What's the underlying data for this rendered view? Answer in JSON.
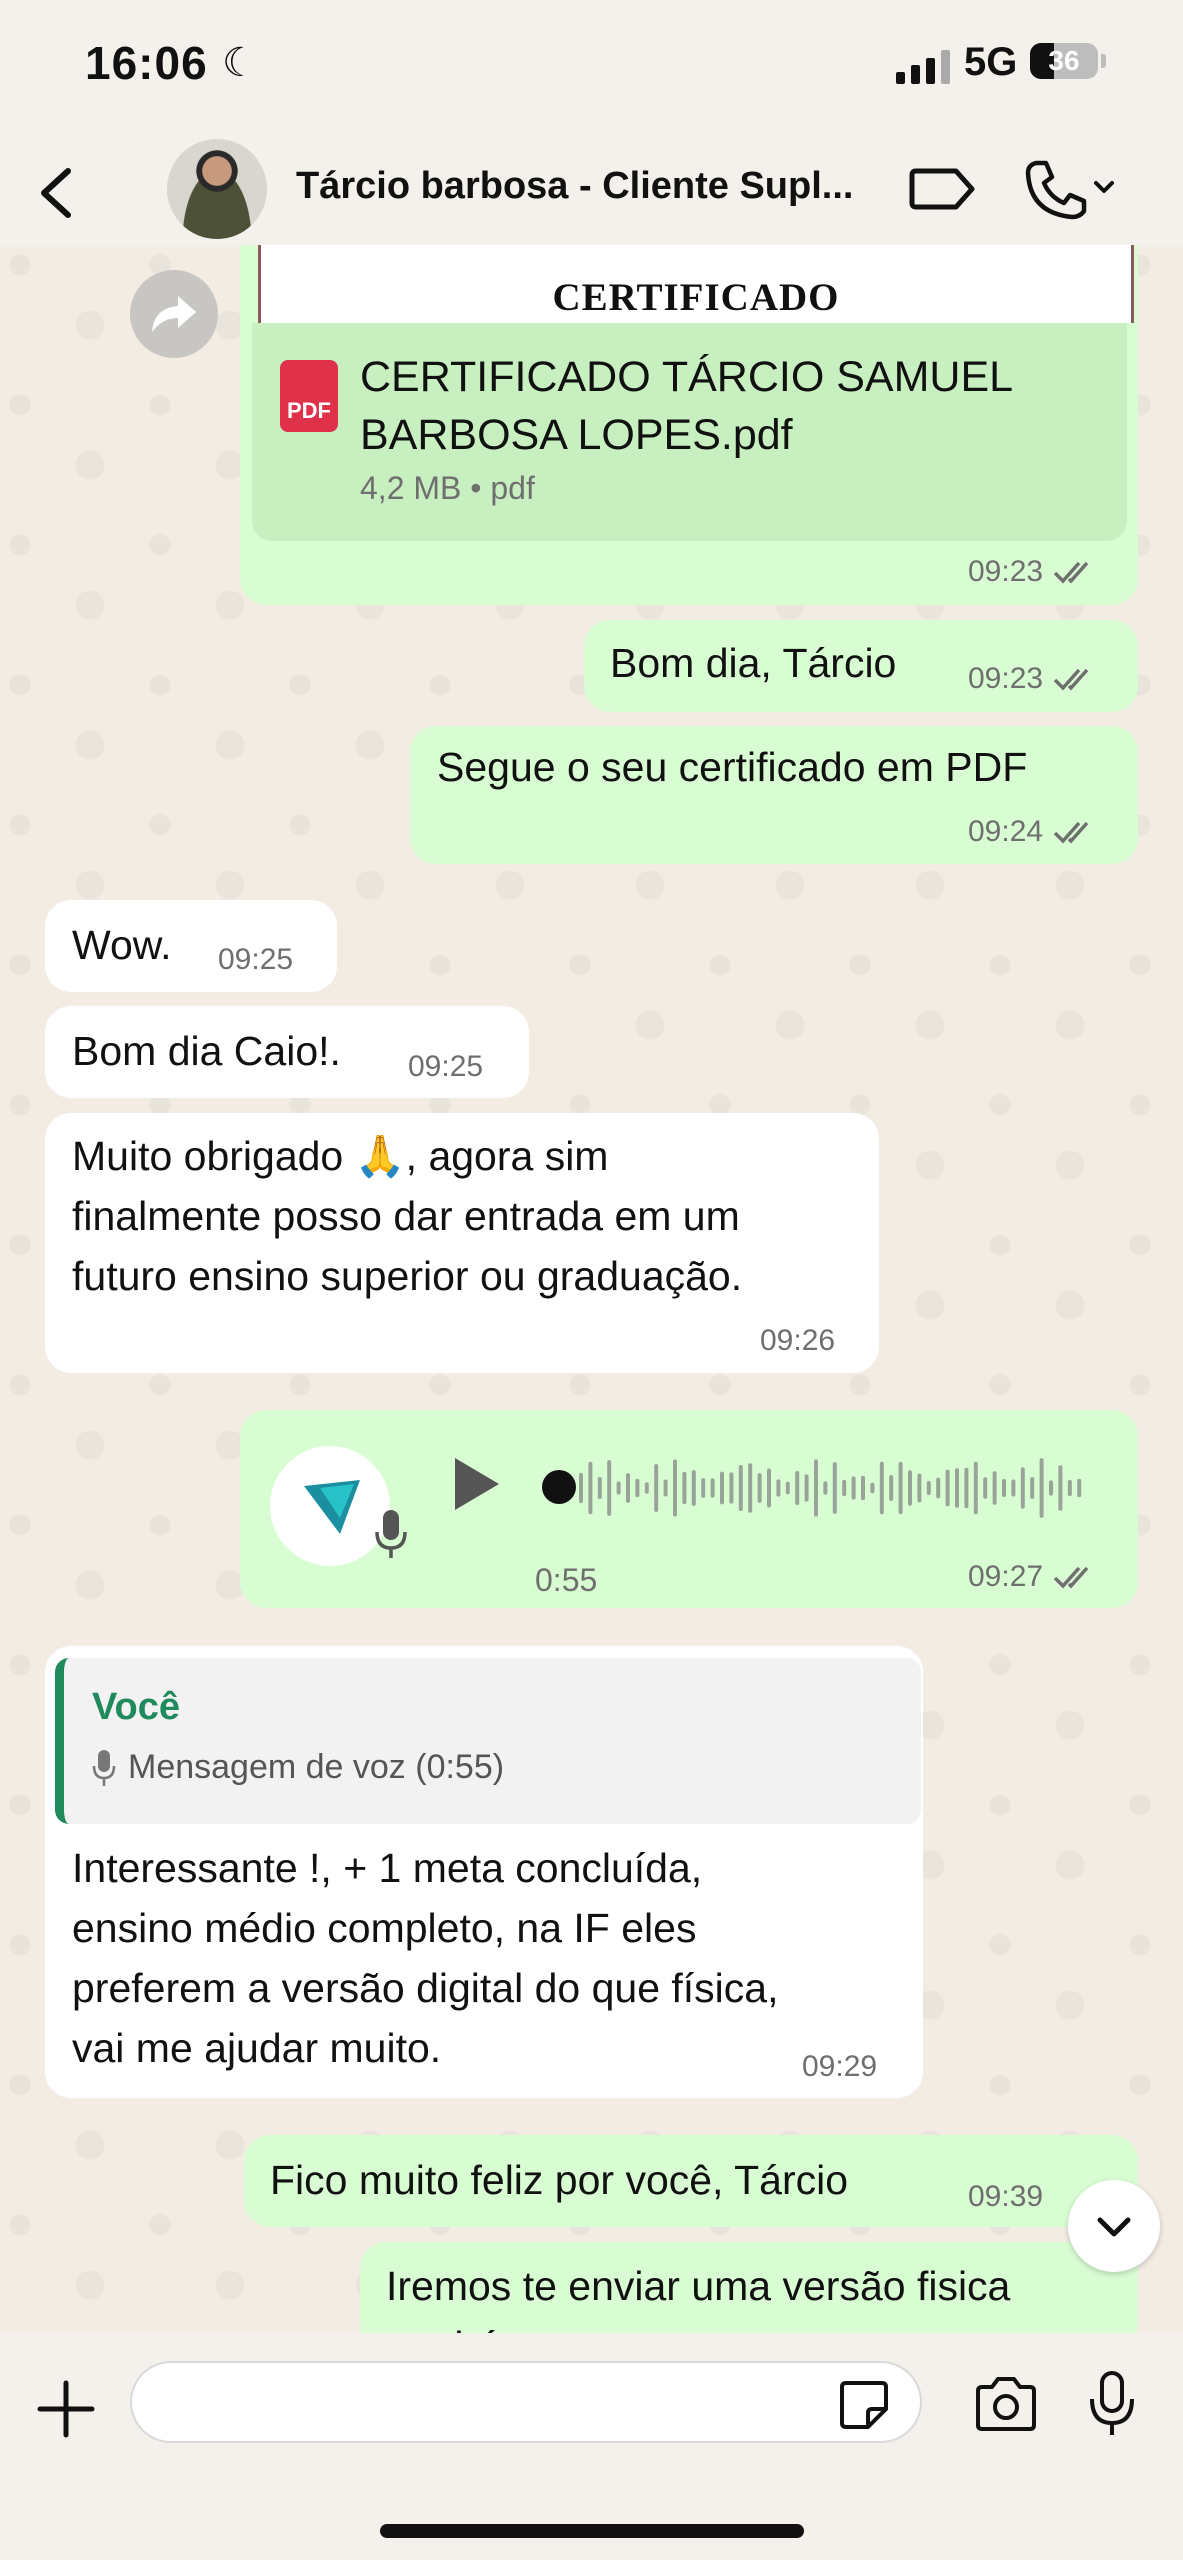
{
  "status_bar": {
    "time": "16:06",
    "network": "5G",
    "battery": "36",
    "battery_level": 0.36
  },
  "header": {
    "contact_name": "Tárcio barbosa - Cliente Supl..."
  },
  "messages": {
    "document": {
      "preview_title": "CERTIFICADO",
      "filename_line1": "CERTIFICADO TÁRCIO SAMUEL",
      "filename_line2": "BARBOSA LOPES.pdf",
      "meta": "4,2 MB • pdf",
      "pdf_label": "PDF",
      "time": "09:23"
    },
    "m1": {
      "text": "Bom dia, Tárcio",
      "time": "09:23"
    },
    "m2": {
      "text": "Segue o seu certificado em PDF",
      "time": "09:24"
    },
    "m3": {
      "text": "Wow.",
      "time": "09:25"
    },
    "m4": {
      "text": "Bom dia Caio!.",
      "time": "09:25"
    },
    "m5": {
      "line1": "Muito obrigado 🙏, agora sim",
      "line2": "finalmente posso dar entrada em um",
      "line3": "futuro ensino superior ou graduação.",
      "time": "09:26"
    },
    "voice": {
      "duration": "0:55",
      "time": "09:27"
    },
    "m6": {
      "quote_author": "Você",
      "quote_text": "Mensagem de voz (0:55)",
      "line1": "Interessante !, + 1 meta concluída,",
      "line2": "ensino médio completo, na IF eles",
      "line3": "preferem a versão digital do que física,",
      "line4": "vai me ajudar muito.",
      "time": "09:29"
    },
    "m7": {
      "text": "Fico muito feliz por você, Tárcio",
      "time": "09:39"
    },
    "m8": {
      "text": "Iremos te enviar uma versão fisica",
      "text_cut": "também"
    }
  },
  "composer": {
    "placeholder": ""
  },
  "colors": {
    "outgoing": "#d9fdd3",
    "incoming": "#ffffff",
    "read_ticks": "#53bdeb",
    "quote_accent": "#1f8a5b"
  }
}
